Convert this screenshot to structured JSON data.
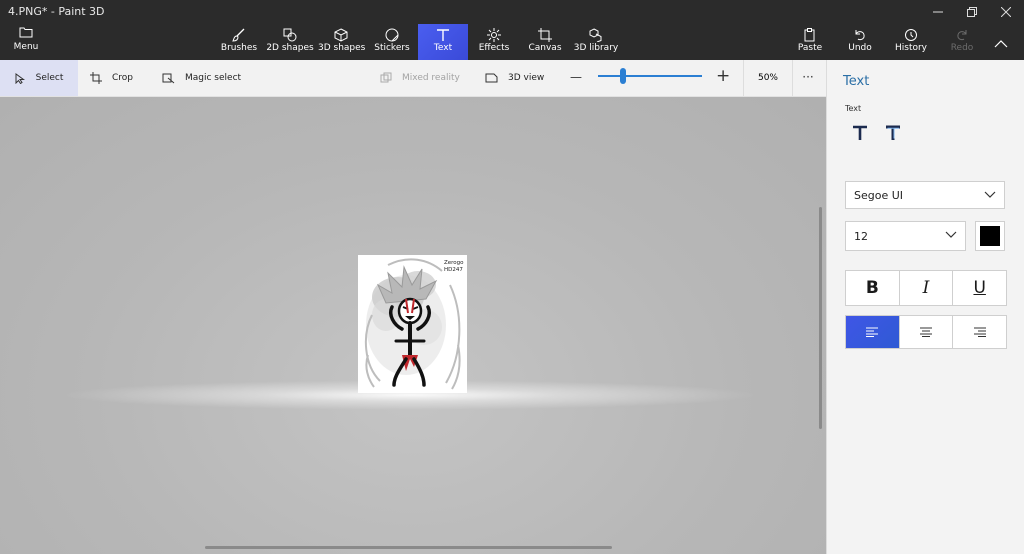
{
  "window": {
    "title": "4.PNG* - Paint 3D"
  },
  "menu": {
    "label": "Menu"
  },
  "toolbar": {
    "tools": [
      {
        "label": "Brushes",
        "icon": "brush-icon"
      },
      {
        "label": "2D shapes",
        "icon": "2d-shapes-icon"
      },
      {
        "label": "3D shapes",
        "icon": "3d-shapes-icon"
      },
      {
        "label": "Stickers",
        "icon": "stickers-icon"
      },
      {
        "label": "Text",
        "icon": "text-icon",
        "active": true
      },
      {
        "label": "Effects",
        "icon": "effects-icon"
      },
      {
        "label": "Canvas",
        "icon": "canvas-icon"
      },
      {
        "label": "3D library",
        "icon": "3d-library-icon"
      }
    ],
    "actions": [
      {
        "label": "Paste",
        "icon": "paste-icon"
      },
      {
        "label": "Undo",
        "icon": "undo-icon"
      },
      {
        "label": "History",
        "icon": "history-icon"
      },
      {
        "label": "Redo",
        "icon": "redo-icon",
        "disabled": true
      }
    ]
  },
  "subbar": {
    "select": "Select",
    "crop": "Crop",
    "magic_select": "Magic select",
    "mixed_reality": "Mixed reality",
    "view_3d": "3D view",
    "zoom_value": "50%",
    "zoom_level": 0.25
  },
  "drawing": {
    "signature": "Zerogo HD247",
    "signature_line1": "Zerogo",
    "signature_line2": "HD247"
  },
  "panel": {
    "title": "Text",
    "subtitle": "Text",
    "font": "Segoe UI",
    "size": "12",
    "color": "#000000",
    "bold": "B",
    "italic": "I",
    "underline": "U",
    "accent": "#3f56e6"
  }
}
